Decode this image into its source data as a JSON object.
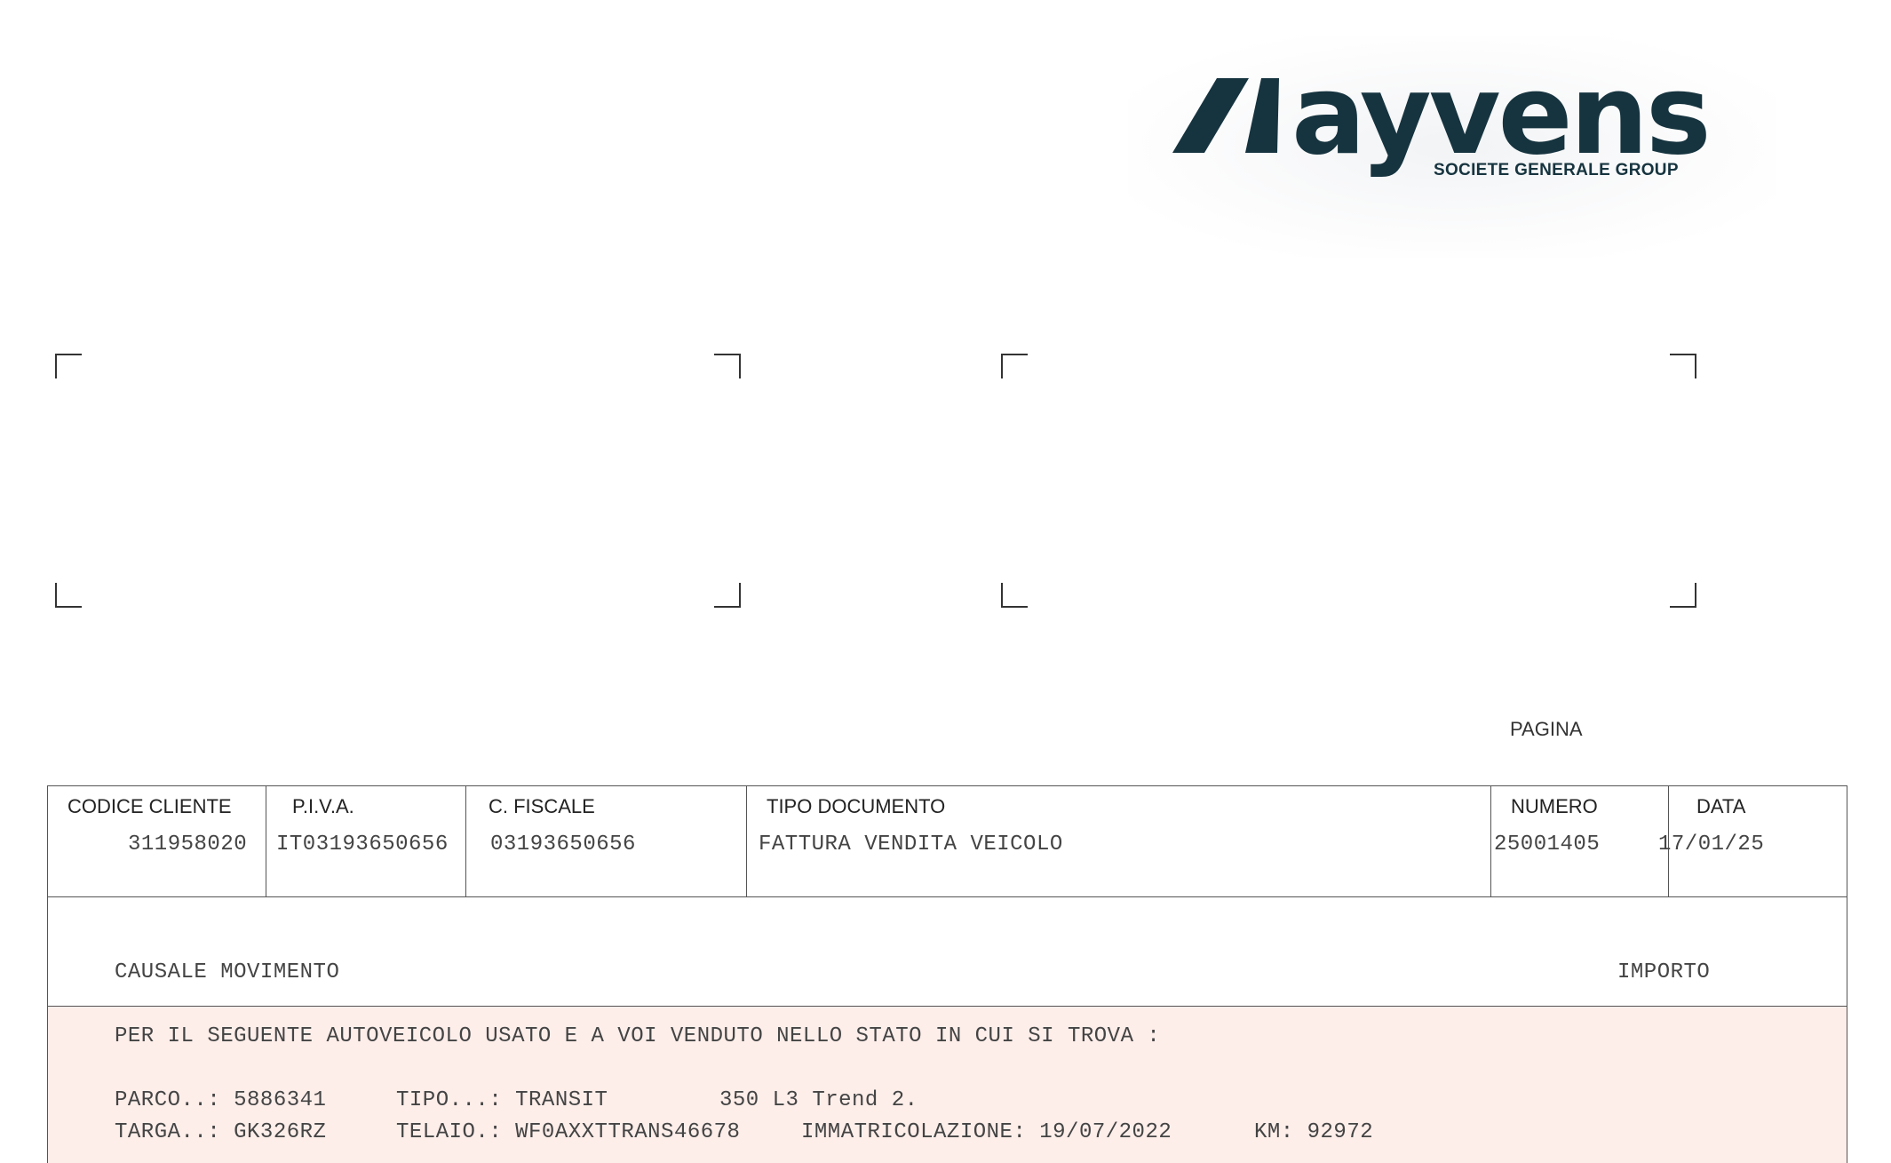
{
  "logo": {
    "wordmark": "ayvens",
    "tagline": "SOCIETE GENERALE GROUP",
    "brand_color": "#16343f"
  },
  "page_label": "PAGINA",
  "header": {
    "codice_cliente": {
      "label": "CODICE CLIENTE",
      "value": "311958020"
    },
    "piva": {
      "label": "P.I.V.A.",
      "value": "IT03193650656"
    },
    "c_fiscale": {
      "label": "C. FISCALE",
      "value": "03193650656"
    },
    "tipo_documento": {
      "label": "TIPO DOCUMENTO",
      "value": "FATTURA VENDITA VEICOLO"
    },
    "numero": {
      "label": "NUMERO",
      "value": "25001405"
    },
    "data": {
      "label": "DATA",
      "value": "17/01/25"
    }
  },
  "columns": {
    "causale": "CAUSALE MOVIMENTO",
    "importo": "IMPORTO"
  },
  "body": {
    "intro": "PER IL SEGUENTE AUTOVEICOLO USATO E A VOI VENDUTO NELLO STATO IN CUI SI TROVA :",
    "parco": "PARCO..: 5886341",
    "tipo": "TIPO...: TRANSIT",
    "modello": "350 L3 Trend 2.",
    "targa": "TARGA..: GK326RZ",
    "telaio": "TELAIO.: WF0AXXTTRANS46678",
    "immatricolazione": "IMMATRICOLAZIONE: 19/07/2022",
    "km": "KM: 92972"
  },
  "body_background": "#fdeeea"
}
